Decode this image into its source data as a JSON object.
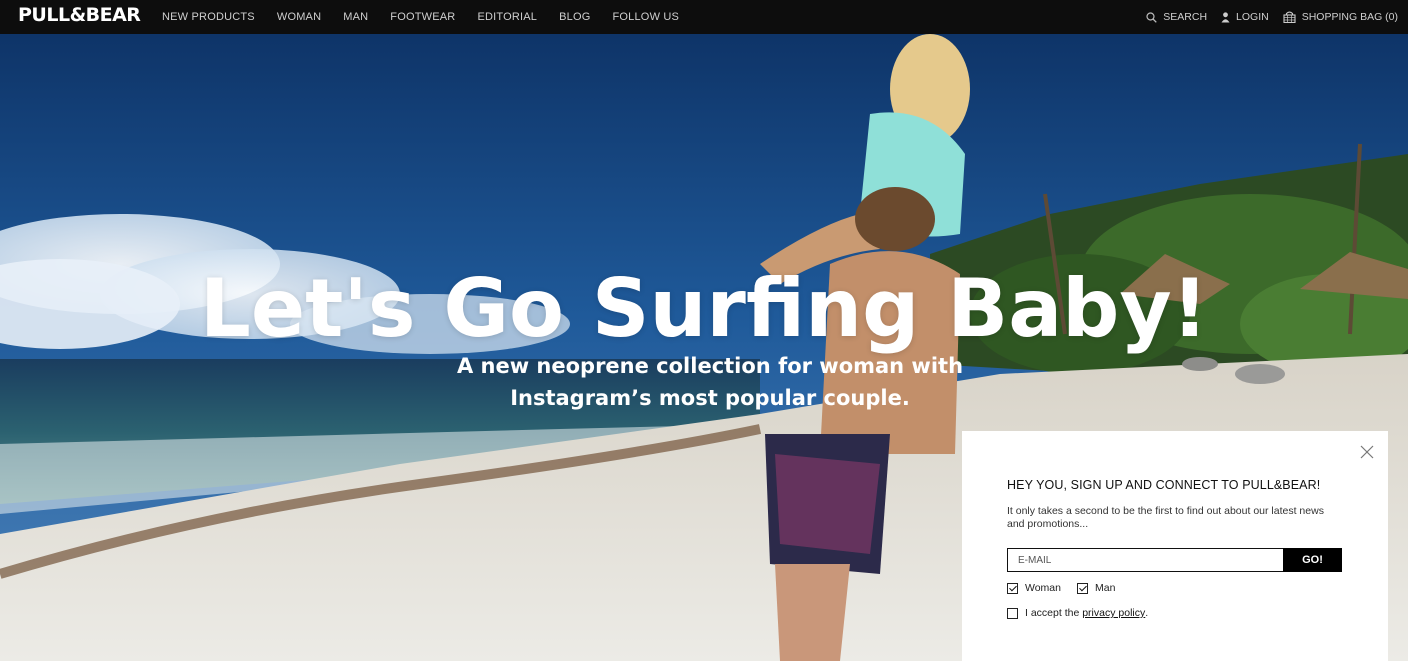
{
  "brand": {
    "logo_text": "PULL&BEAR"
  },
  "nav": {
    "items": [
      {
        "label": "NEW PRODUCTS"
      },
      {
        "label": "WOMAN"
      },
      {
        "label": "MAN"
      },
      {
        "label": "FOOTWEAR"
      },
      {
        "label": "EDITORIAL"
      },
      {
        "label": "BLOG"
      },
      {
        "label": "FOLLOW US"
      }
    ],
    "search_label": "SEARCH",
    "login_label": "LOGIN",
    "bag_label": "SHOPPING BAG (0)"
  },
  "hero": {
    "headline": "Let's Go Surfing Baby!",
    "sub_line1": "A new neoprene collection for woman with",
    "sub_line2": "Instagram’s most popular couple."
  },
  "signup": {
    "title": "HEY YOU, SIGN UP AND CONNECT TO PULL&BEAR!",
    "description": "It only takes a second to be the first to find out about our latest news and promotions...",
    "email_placeholder": "E-MAIL",
    "submit_label": "GO!",
    "woman_label": "Woman",
    "woman_checked": true,
    "man_label": "Man",
    "man_checked": true,
    "privacy_prefix": "I accept the",
    "privacy_link": "privacy policy",
    "privacy_suffix": ".",
    "privacy_checked": false
  },
  "icons": [
    "search-icon",
    "user-icon",
    "shopping-bag-icon",
    "close-icon",
    "checkmark-icon"
  ],
  "colors": {
    "nav_bg": "#0d0d0d",
    "panel_bg": "#ffffff",
    "button_bg": "#000000"
  }
}
